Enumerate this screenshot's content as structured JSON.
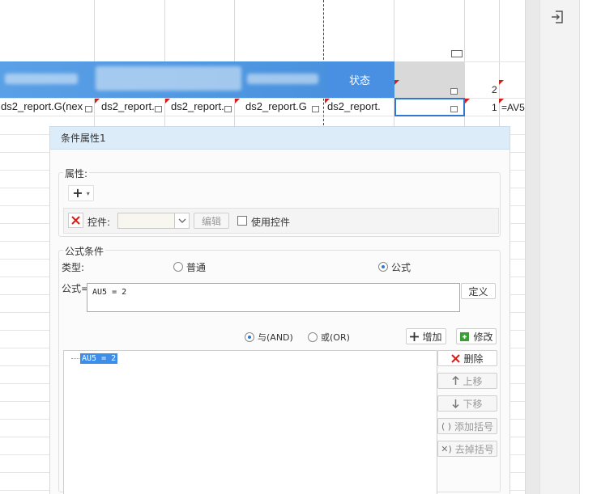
{
  "spreadsheet": {
    "header_status": "状态",
    "row3": {
      "cells": [
        "ds2_report.G(nex",
        "ds2_report.",
        "ds2_report.",
        "ds2_report.G",
        "ds2_report."
      ],
      "count_upper": "2",
      "count_lower": "1",
      "formula_hint": "=AV5"
    }
  },
  "sidebar": {
    "icon": "import-icon"
  },
  "dialog": {
    "title": "条件属性1",
    "attributes": {
      "section_label": "属性:",
      "add_symbol": "+",
      "control_label": "控件:",
      "control_value": "",
      "edit_button": "编辑",
      "use_control_label": "使用控件"
    },
    "formula_condition": {
      "section_label": "公式条件",
      "type_label": "类型:",
      "type_options": [
        "普通",
        "公式"
      ],
      "type_selected": "公式",
      "formula_label": "公式=",
      "formula_value": "AU5 = 2",
      "define_button": "定义",
      "logic_and": "与(AND)",
      "logic_or": "或(OR)",
      "logic_selected": "与(AND)",
      "add_button": "增加",
      "modify_button": "修改",
      "delete_button": "删除",
      "move_up_button": "上移",
      "move_down_button": "下移",
      "add_bracket_button": "添加括号",
      "remove_bracket_button": "去掉括号",
      "conditions": [
        "AU5 = 2"
      ]
    }
  }
}
